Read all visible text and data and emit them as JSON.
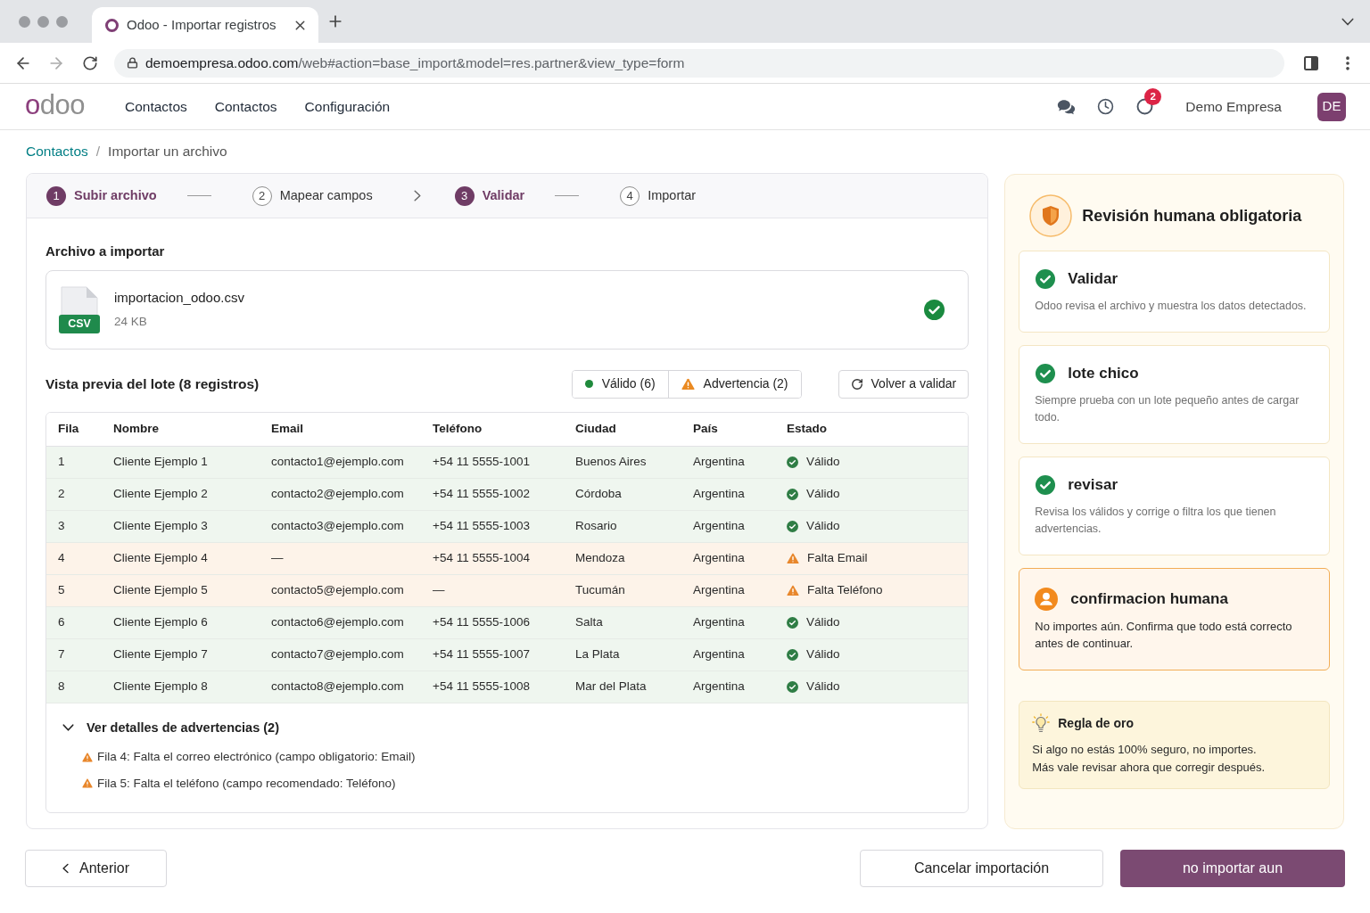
{
  "browser": {
    "tab_title": "Odoo - Importar registros",
    "url_host": "demoempresa.odoo.com",
    "url_path": "/web#action=base_import&model=res.partner&view_type=form"
  },
  "navbar": {
    "logo": "odoo",
    "menu": [
      "Contactos",
      "Contactos",
      "Configuración"
    ],
    "notification_count": "2",
    "user_name": "Demo Empresa",
    "avatar_initials": "DE"
  },
  "breadcrumb": {
    "items": [
      {
        "label": "Contactos",
        "current": false
      },
      {
        "label": "Importar un archivo",
        "current": true
      }
    ],
    "separator": "/"
  },
  "steps": [
    {
      "number": "1",
      "label": "Subir archivo",
      "active": true
    },
    {
      "number": "2",
      "label": "Mapear campos",
      "active": false
    },
    {
      "number": "3",
      "label": "Validar",
      "active": true
    },
    {
      "number": "4",
      "label": "Importar",
      "active": false
    }
  ],
  "step_connectors": [
    {
      "kind": "line"
    },
    {
      "kind": "chevron"
    },
    {
      "kind": "line"
    }
  ],
  "file_section": {
    "title": "Archivo a importar",
    "file_name": "importacion_odoo.csv",
    "file_size": "24 KB",
    "file_type": "CSV",
    "validated": true
  },
  "preview": {
    "title": "Vista previa del lote (8 registros)",
    "filters": [
      {
        "kind": "valid",
        "label": "Válido (6)"
      },
      {
        "kind": "warning",
        "label": "Advertencia (2)"
      }
    ],
    "revalidate_button": "Volver a validar"
  },
  "table": {
    "columns": [
      "Fila",
      "Nombre",
      "Email",
      "Teléfono",
      "Ciudad",
      "País",
      "Estado"
    ],
    "rows": [
      {
        "cells": [
          "1",
          "Cliente Ejemplo 1",
          "contacto1@ejemplo.com",
          "+54 11 5555-1001",
          "Buenos Aires",
          "Argentina"
        ],
        "kind": "valid",
        "status_label": "Válido"
      },
      {
        "cells": [
          "2",
          "Cliente Ejemplo 2",
          "contacto2@ejemplo.com",
          "+54 11 5555-1002",
          "Córdoba",
          "Argentina"
        ],
        "kind": "valid",
        "status_label": "Válido"
      },
      {
        "cells": [
          "3",
          "Cliente Ejemplo 3",
          "contacto3@ejemplo.com",
          "+54 11 5555-1003",
          "Rosario",
          "Argentina"
        ],
        "kind": "valid",
        "status_label": "Válido"
      },
      {
        "cells": [
          "4",
          "Cliente Ejemplo 4",
          "—",
          "+54 11 5555-1004",
          "Mendoza",
          "Argentina"
        ],
        "kind": "warning",
        "status_label": "Falta Email"
      },
      {
        "cells": [
          "5",
          "Cliente Ejemplo 5",
          "contacto5@ejemplo.com",
          "—",
          "Tucumán",
          "Argentina"
        ],
        "kind": "warning",
        "status_label": "Falta Teléfono"
      },
      {
        "cells": [
          "6",
          "Cliente Ejemplo 6",
          "contacto6@ejemplo.com",
          "+54 11 5555-1006",
          "Salta",
          "Argentina"
        ],
        "kind": "valid",
        "status_label": "Válido"
      },
      {
        "cells": [
          "7",
          "Cliente Ejemplo 7",
          "contacto7@ejemplo.com",
          "+54 11 5555-1007",
          "La Plata",
          "Argentina"
        ],
        "kind": "valid",
        "status_label": "Válido"
      },
      {
        "cells": [
          "8",
          "Cliente Ejemplo 8",
          "contacto8@ejemplo.com",
          "+54 11 5555-1008",
          "Mar del Plata",
          "Argentina"
        ],
        "kind": "valid",
        "status_label": "Válido"
      }
    ]
  },
  "warnings": {
    "title": "Ver detalles de advertencias (2)",
    "expanded": true,
    "items": [
      "Fila 4: Falta el correo electrónico (campo obligatorio: Email)",
      "Fila 5: Falta el teléfono (campo recomendado: Teléfono)"
    ]
  },
  "review_panel": {
    "title": "Revisión humana obligatoria",
    "cards": [
      {
        "kind": "done",
        "title": "Validar",
        "text": "Odoo revisa el archivo y muestra los datos detectados."
      },
      {
        "kind": "done",
        "title": "lote chico",
        "text": "Siempre prueba con un lote pequeño antes de cargar todo."
      },
      {
        "kind": "done",
        "title": "revisar",
        "text": "Revisa los válidos y corrige o filtra los que tienen advertencias."
      },
      {
        "kind": "attention",
        "title": "confirmacion humana",
        "text": "No importes aún. Confirma que todo está correcto antes de continuar."
      }
    ],
    "tip": {
      "title": "Regla de oro",
      "lines": [
        "Si algo no estás 100% seguro, no importes.",
        "Más vale revisar ahora que corregir después."
      ]
    }
  },
  "footer": {
    "back_button": "Anterior",
    "cancel_button": "Cancelar importación",
    "primary_button": "no importar aun"
  }
}
